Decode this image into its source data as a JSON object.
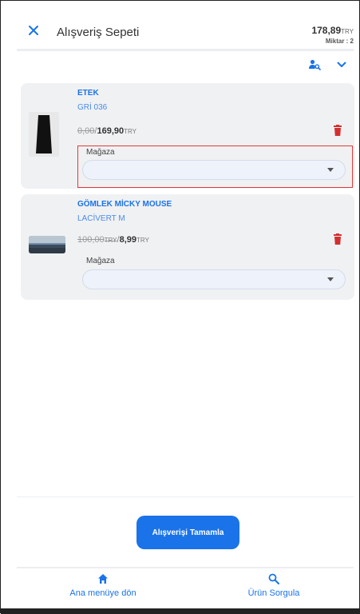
{
  "header": {
    "title": "Alışveriş Sepeti",
    "close_icon": "close-icon",
    "total_amount": "178,89",
    "total_currency": "TRY",
    "quantity_label": "Miktar : 2"
  },
  "tools": {
    "customer_search_icon": "person-search-icon",
    "expand_icon": "chevron-down-icon"
  },
  "items": [
    {
      "name": "ETEK",
      "variant": "GRİ 036",
      "old_price": "0,00",
      "old_currency": "",
      "new_price": "169,90",
      "currency": "TRY",
      "store_label": "Mağaza",
      "store_value": ""
    },
    {
      "name": "GÖMLEK MİCKY MOUSE",
      "variant": "LACİVERT M",
      "old_price": "100,00",
      "old_currency": "TRY",
      "new_price": "8,99",
      "currency": "TRY",
      "store_label": "Mağaza",
      "store_value": ""
    }
  ],
  "actions": {
    "complete_label": "Alışverişi Tamamla"
  },
  "nav": {
    "home_label": "Ana menüye dön",
    "search_label": "Ürün Sorgula"
  },
  "colors": {
    "accent": "#1a73e8",
    "danger": "#d32f2f",
    "card_bg": "#f0f1f3",
    "highlight": "#e53935"
  }
}
